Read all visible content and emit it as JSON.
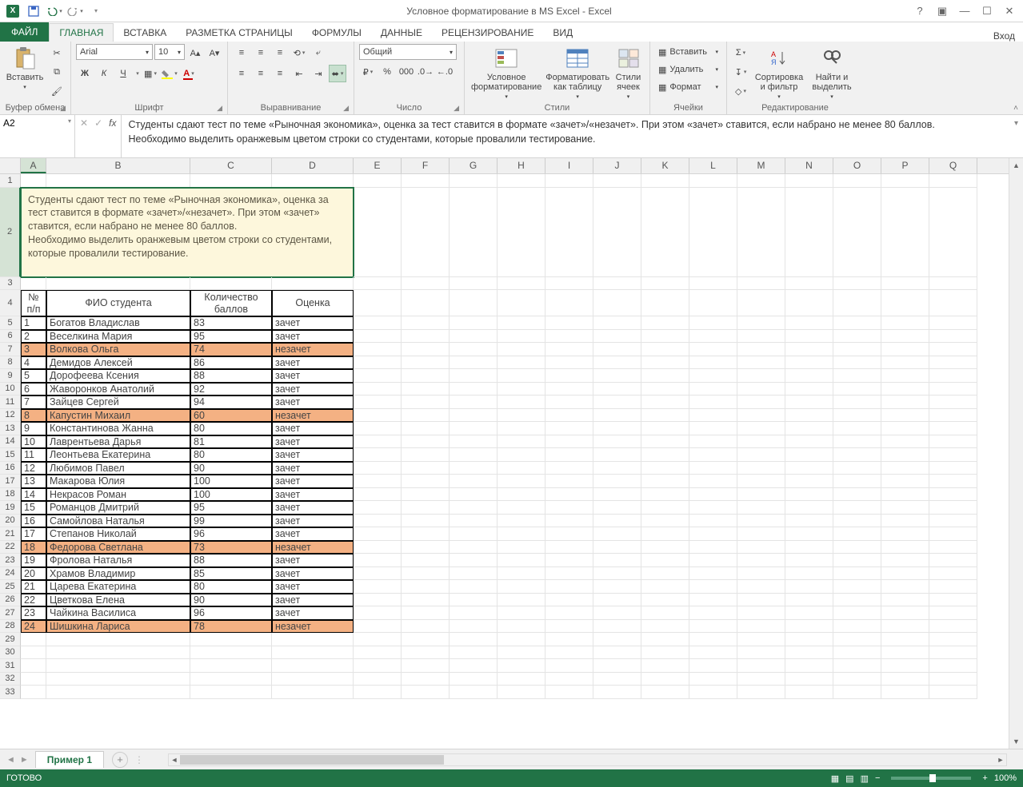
{
  "title": "Условное форматирование в MS Excel - Excel",
  "login": "Вход",
  "tabs": {
    "file": "ФАЙЛ",
    "home": "ГЛАВНАЯ",
    "insert": "ВСТАВКА",
    "layout": "РАЗМЕТКА СТРАНИЦЫ",
    "formulas": "ФОРМУЛЫ",
    "data": "ДАННЫЕ",
    "review": "РЕЦЕНЗИРОВАНИЕ",
    "view": "ВИД"
  },
  "ribbon": {
    "clipboard": {
      "label": "Буфер обмена",
      "paste": "Вставить"
    },
    "font": {
      "label": "Шрифт",
      "name": "Arial",
      "size": "10"
    },
    "align": {
      "label": "Выравнивание"
    },
    "number": {
      "label": "Число",
      "format": "Общий"
    },
    "styles": {
      "label": "Стили",
      "cond": "Условное форматирование",
      "table": "Форматировать как таблицу",
      "cell": "Стили ячеек"
    },
    "cells": {
      "label": "Ячейки",
      "insert": "Вставить",
      "delete": "Удалить",
      "format": "Формат"
    },
    "editing": {
      "label": "Редактирование",
      "sort": "Сортировка и фильтр",
      "find": "Найти и выделить"
    }
  },
  "namebox": "A2",
  "formula": "Студенты сдают тест по теме «Рыночная экономика», оценка за тест ставится в формате «зачет»/«незачет». При этом «зачет» ставится, если набрано не менее 80 баллов.\nНеобходимо выделить оранжевым цветом строки со студентами, которые провалили тестирование.",
  "note": "Студенты сдают тест по теме «Рыночная экономика», оценка за тест ставится в формате «зачет»/«незачет». При этом «зачет» ставится, если набрано не менее 80 баллов.\nНеобходимо выделить оранжевым цветом строки со студентами, которые провалили тестирование.",
  "table": {
    "headers": {
      "n": "№ п/п",
      "fio": "ФИО студента",
      "score": "Количество баллов",
      "grade": "Оценка"
    },
    "rows": [
      {
        "n": "1",
        "fio": "Богатов Владислав",
        "score": "83",
        "grade": "зачет",
        "fail": false
      },
      {
        "n": "2",
        "fio": "Веселкина Мария",
        "score": "95",
        "grade": "зачет",
        "fail": false
      },
      {
        "n": "3",
        "fio": "Волкова Ольга",
        "score": "74",
        "grade": "незачет",
        "fail": true
      },
      {
        "n": "4",
        "fio": "Демидов Алексей",
        "score": "86",
        "grade": "зачет",
        "fail": false
      },
      {
        "n": "5",
        "fio": "Дорофеева Ксения",
        "score": "88",
        "grade": "зачет",
        "fail": false
      },
      {
        "n": "6",
        "fio": "Жаворонков Анатолий",
        "score": "92",
        "grade": "зачет",
        "fail": false
      },
      {
        "n": "7",
        "fio": "Зайцев Сергей",
        "score": "94",
        "grade": "зачет",
        "fail": false
      },
      {
        "n": "8",
        "fio": "Капустин Михаил",
        "score": "60",
        "grade": "незачет",
        "fail": true
      },
      {
        "n": "9",
        "fio": "Константинова Жанна",
        "score": "80",
        "grade": "зачет",
        "fail": false
      },
      {
        "n": "10",
        "fio": "Лаврентьева Дарья",
        "score": "81",
        "grade": "зачет",
        "fail": false
      },
      {
        "n": "11",
        "fio": "Леонтьева Екатерина",
        "score": "80",
        "grade": "зачет",
        "fail": false
      },
      {
        "n": "12",
        "fio": "Любимов Павел",
        "score": "90",
        "grade": "зачет",
        "fail": false
      },
      {
        "n": "13",
        "fio": "Макарова Юлия",
        "score": "100",
        "grade": "зачет",
        "fail": false
      },
      {
        "n": "14",
        "fio": "Некрасов Роман",
        "score": "100",
        "grade": "зачет",
        "fail": false
      },
      {
        "n": "15",
        "fio": "Романцов Дмитрий",
        "score": "95",
        "grade": "зачет",
        "fail": false
      },
      {
        "n": "16",
        "fio": "Самойлова Наталья",
        "score": "99",
        "grade": "зачет",
        "fail": false
      },
      {
        "n": "17",
        "fio": "Степанов Николай",
        "score": "96",
        "grade": "зачет",
        "fail": false
      },
      {
        "n": "18",
        "fio": "Федорова Светлана",
        "score": "73",
        "grade": "незачет",
        "fail": true
      },
      {
        "n": "19",
        "fio": "Фролова Наталья",
        "score": "88",
        "grade": "зачет",
        "fail": false
      },
      {
        "n": "20",
        "fio": "Храмов Владимир",
        "score": "85",
        "grade": "зачет",
        "fail": false
      },
      {
        "n": "21",
        "fio": "Царева Екатерина",
        "score": "80",
        "grade": "зачет",
        "fail": false
      },
      {
        "n": "22",
        "fio": "Цветкова Елена",
        "score": "90",
        "grade": "зачет",
        "fail": false
      },
      {
        "n": "23",
        "fio": "Чайкина Василиса",
        "score": "96",
        "grade": "зачет",
        "fail": false
      },
      {
        "n": "24",
        "fio": "Шишкина Лариса",
        "score": "78",
        "grade": "незачет",
        "fail": true
      }
    ]
  },
  "sheet": "Пример 1",
  "status": {
    "ready": "ГОТОВО",
    "zoom": "100%"
  },
  "cols": [
    "A",
    "B",
    "C",
    "D",
    "E",
    "F",
    "G",
    "H",
    "I",
    "J",
    "K",
    "L",
    "M",
    "N",
    "O",
    "P",
    "Q"
  ]
}
